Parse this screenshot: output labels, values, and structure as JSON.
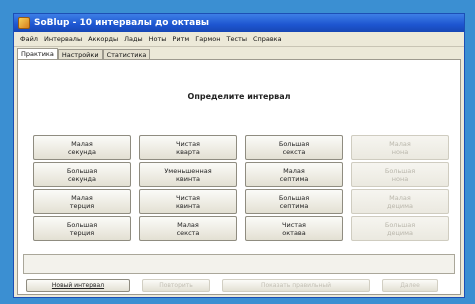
{
  "window": {
    "title": "SoBlup - 10 интервалы до октавы"
  },
  "menu": [
    "Файл",
    "Интервалы",
    "Аккорды",
    "Лады",
    "Ноты",
    "Ритм",
    "Гармон",
    "Тесты",
    "Справка"
  ],
  "tabs": [
    {
      "label": "Практика",
      "active": true
    },
    {
      "label": "Настройки",
      "active": false
    },
    {
      "label": "Статистика",
      "active": false
    }
  ],
  "prompt": "Определите интервал",
  "answers": [
    {
      "line1": "Малая",
      "line2": "секунда",
      "enabled": true
    },
    {
      "line1": "Чистая",
      "line2": "кварта",
      "enabled": true
    },
    {
      "line1": "Большая",
      "line2": "секста",
      "enabled": true
    },
    {
      "line1": "Малая",
      "line2": "нона",
      "enabled": false
    },
    {
      "line1": "Большая",
      "line2": "секунда",
      "enabled": true
    },
    {
      "line1": "Уменьшенная",
      "line2": "квинта",
      "enabled": true
    },
    {
      "line1": "Малая",
      "line2": "септима",
      "enabled": true
    },
    {
      "line1": "Большая",
      "line2": "нона",
      "enabled": false
    },
    {
      "line1": "Малая",
      "line2": "терция",
      "enabled": true
    },
    {
      "line1": "Чистая",
      "line2": "квинта",
      "enabled": true
    },
    {
      "line1": "Большая",
      "line2": "септима",
      "enabled": true
    },
    {
      "line1": "Малая",
      "line2": "децима",
      "enabled": false
    },
    {
      "line1": "Большая",
      "line2": "терция",
      "enabled": true
    },
    {
      "line1": "Малая",
      "line2": "секста",
      "enabled": true
    },
    {
      "line1": "Чистая",
      "line2": "октава",
      "enabled": true
    },
    {
      "line1": "Большая",
      "line2": "децима",
      "enabled": false
    }
  ],
  "bottom": {
    "new_label": "Новый интервал",
    "repeat_label": "Повторить",
    "check_label": "Показать правильный",
    "skip_label": "Далее"
  },
  "colors": {
    "desktop": "#3b8fd2",
    "titlebar": "#1d55d0",
    "window_bg": "#ece9d8"
  }
}
